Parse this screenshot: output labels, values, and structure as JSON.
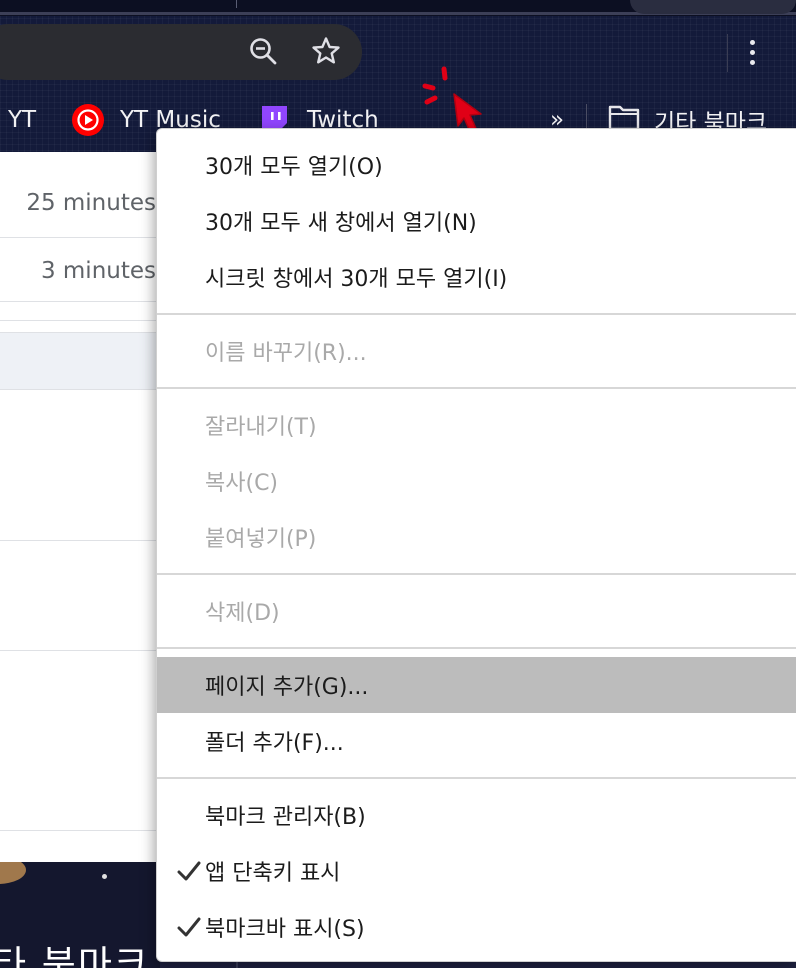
{
  "bookmarks_bar": {
    "items": [
      {
        "label": "YT",
        "icon": "yt-text"
      },
      {
        "label": "YT Music",
        "icon": "youtube-music-icon"
      },
      {
        "label": "Twitch",
        "icon": "twitch-icon"
      }
    ],
    "overflow_label": "»",
    "other_bookmarks_label": "기타 북마크"
  },
  "history_rows": [
    {
      "time": "25 minutes"
    },
    {
      "time": "3 minutes"
    }
  ],
  "bottom_folder_text": "타 북마크",
  "context_menu": {
    "groups": [
      [
        {
          "label": "30개 모두 열기(O)",
          "enabled": true
        },
        {
          "label": "30개 모두 새 창에서 열기(N)",
          "enabled": true
        },
        {
          "label": "시크릿 창에서 30개 모두 열기(I)",
          "enabled": true
        }
      ],
      [
        {
          "label": "이름 바꾸기(R)...",
          "enabled": false
        }
      ],
      [
        {
          "label": "잘라내기(T)",
          "enabled": false
        },
        {
          "label": "복사(C)",
          "enabled": false
        },
        {
          "label": "붙여넣기(P)",
          "enabled": false
        }
      ],
      [
        {
          "label": "삭제(D)",
          "enabled": false
        }
      ],
      [
        {
          "label": "페이지 추가(G)...",
          "enabled": true,
          "highlighted": true
        },
        {
          "label": "폴더 추가(F)...",
          "enabled": true
        }
      ],
      [
        {
          "label": "북마크 관리자(B)",
          "enabled": true
        },
        {
          "label": "앱 단축키 표시",
          "enabled": true,
          "checked": true
        },
        {
          "label": "북마크바 표시(S)",
          "enabled": true,
          "checked": true
        }
      ]
    ],
    "check_glyph": "✓"
  },
  "colors": {
    "menu_highlight": "#bcbcbc",
    "disabled_text": "#a9a9a9",
    "youtube_red": "#ff0000",
    "twitch_purple": "#9146ff",
    "cursor_red": "#e00016"
  }
}
